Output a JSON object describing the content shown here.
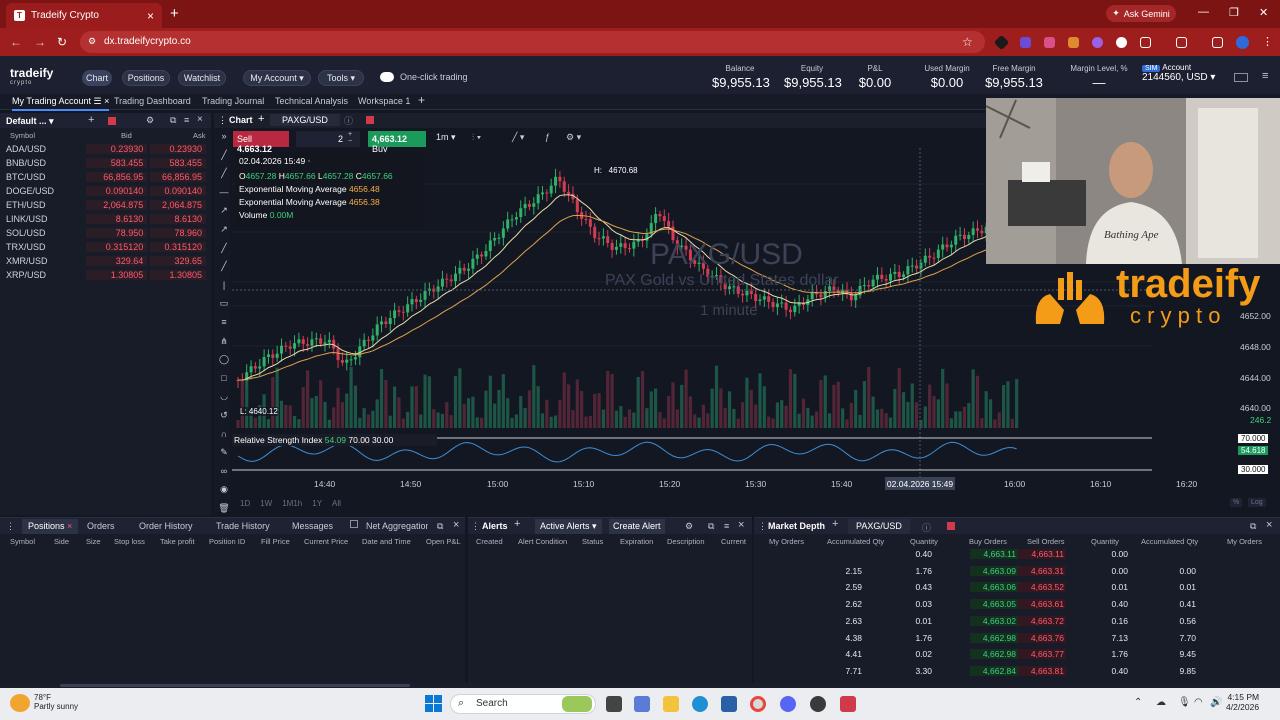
{
  "browser": {
    "tab_title": "Tradeify Crypto",
    "url": "dx.tradeifycrypto.co",
    "ask_gemini": "Ask Gemini"
  },
  "app": {
    "logo_main": "tradeify",
    "logo_sub": "crypto",
    "nav": [
      "Chart",
      "Positions",
      "Watchlist"
    ],
    "my_account": "My Account",
    "tools": "Tools",
    "one_click": "One-click trading",
    "stats": [
      {
        "label": "Balance",
        "value": "$9,955.13"
      },
      {
        "label": "Equity",
        "value": "$9,955.13"
      },
      {
        "label": "P&L",
        "value": "$0.00"
      },
      {
        "label": "Used Margin",
        "value": "$0.00"
      },
      {
        "label": "Free Margin",
        "value": "$9,955.13"
      },
      {
        "label": "Margin Level, %",
        "value": "—"
      }
    ],
    "account_tag": "SIM",
    "account_label": "Account",
    "account_value": "2144560, USD"
  },
  "workspace_tabs": [
    "My Trading Account",
    "Trading Dashboard",
    "Trading Journal",
    "Technical Analysis",
    "Workspace 1"
  ],
  "watchlist": {
    "title": "Default ...",
    "col_symbol": "Symbol",
    "col_bid": "Bid",
    "col_ask": "Ask",
    "rows": [
      {
        "sym": "ADA/USD",
        "bid": "0.23930",
        "ask": "0.23930"
      },
      {
        "sym": "BNB/USD",
        "bid": "583.455",
        "ask": "583.455"
      },
      {
        "sym": "BTC/USD",
        "bid": "66,856.95",
        "ask": "66,856.95"
      },
      {
        "sym": "DOGE/USD",
        "bid": "0.090140",
        "ask": "0.090140"
      },
      {
        "sym": "ETH/USD",
        "bid": "2,064.875",
        "ask": "2,064.875"
      },
      {
        "sym": "LINK/USD",
        "bid": "8.6130",
        "ask": "8.6130"
      },
      {
        "sym": "SOL/USD",
        "bid": "78.950",
        "ask": "78.960"
      },
      {
        "sym": "TRX/USD",
        "bid": "0.315120",
        "ask": "0.315120"
      },
      {
        "sym": "XMR/USD",
        "bid": "329.64",
        "ask": "329.65"
      },
      {
        "sym": "XRP/USD",
        "bid": "1.30805",
        "ask": "1.30805"
      }
    ]
  },
  "chart": {
    "panel_title": "Chart",
    "symbol": "PAXG/USD",
    "sell_label": "Sell",
    "sell_price": "4,663.12",
    "qty": "2",
    "buy_price": "4,663.12",
    "buy_label": "Buy",
    "interval": "1m",
    "info_date": "02.04.2026 15:49",
    "ohlc": {
      "o": "4657.28",
      "h": "4657.66",
      "l": "4657.28",
      "c": "4657.66"
    },
    "ema1_label": "Exponential Moving Average",
    "ema1_val": "4656.48",
    "ema2_label": "Exponential Moving Average",
    "ema2_val": "4656.38",
    "vol_label": "Volume",
    "vol_val": "0.00M",
    "high_label": "H:",
    "high_val": "4670.68",
    "low_label": "L:",
    "low_val": "4640.12",
    "wm_symbol": "PAXG/USD",
    "wm_name": "PAX Gold vs United States dollar",
    "wm_interval": "1 minute",
    "y_ticks": [
      "4652.00",
      "4648.00",
      "4644.00",
      "4640.00",
      "246.2"
    ],
    "x_ticks": [
      "14:40",
      "14:50",
      "15:00",
      "15:10",
      "15:20",
      "15:30",
      "15:40",
      "02.04.2026 15:49",
      "16:00",
      "16:10",
      "16:20"
    ],
    "rsi_label": "Relative Strength Index",
    "rsi_val": "54.09",
    "rsi_hi": "70.00",
    "rsi_lo": "30.00",
    "rsi_ticks": [
      "70.000",
      "54.618",
      "30.000"
    ],
    "ranges": [
      "1D",
      "1W",
      "1M1h",
      "1Y",
      "All"
    ],
    "log_btn": "Log"
  },
  "positions_panel": {
    "tabs": [
      "Positions",
      "Orders",
      "Order History",
      "Trade History",
      "Messages",
      "Net Aggregation"
    ],
    "columns": [
      "Symbol",
      "Side",
      "Size",
      "Stop loss",
      "Take profit",
      "Position ID",
      "Fill Price",
      "Current Price",
      "Date and Time",
      "Open P&L"
    ]
  },
  "alerts_panel": {
    "title": "Alerts",
    "active": "Active Alerts",
    "create": "Create Alert",
    "columns": [
      "Created",
      "Alert Condition",
      "Status",
      "Expiration",
      "Description",
      "Current"
    ]
  },
  "market_depth": {
    "title": "Market Depth",
    "symbol": "PAXG/USD",
    "columns": [
      "My Orders",
      "Accumulated Qty",
      "Quantity",
      "Buy Orders",
      "Sell Orders",
      "Quantity",
      "Accumulated Qty",
      "My Orders"
    ],
    "rows": [
      {
        "acc_b": "",
        "qty_b": "0.40",
        "buy": "4,663.11",
        "sell": "4,663.11",
        "qty_s": "0.00",
        "acc_s": ""
      },
      {
        "acc_b": "2.15",
        "qty_b": "1.76",
        "buy": "4,663.09",
        "sell": "4,663.31",
        "qty_s": "0.00",
        "acc_s": "0.00"
      },
      {
        "acc_b": "2.59",
        "qty_b": "0.43",
        "buy": "4,663.06",
        "sell": "4,663.52",
        "qty_s": "0.01",
        "acc_s": "0.01"
      },
      {
        "acc_b": "2.62",
        "qty_b": "0.03",
        "buy": "4,663.05",
        "sell": "4,663.61",
        "qty_s": "0.40",
        "acc_s": "0.41"
      },
      {
        "acc_b": "2.63",
        "qty_b": "0.01",
        "buy": "4,663.02",
        "sell": "4,663.72",
        "qty_s": "0.16",
        "acc_s": "0.56"
      },
      {
        "acc_b": "4.38",
        "qty_b": "1.76",
        "buy": "4,662.98",
        "sell": "4,663.76",
        "qty_s": "7.13",
        "acc_s": "7.70"
      },
      {
        "acc_b": "4.41",
        "qty_b": "0.02",
        "buy": "4,662.98",
        "sell": "4,663.77",
        "qty_s": "1.76",
        "acc_s": "9.45"
      },
      {
        "acc_b": "7.71",
        "qty_b": "3.30",
        "buy": "4,662.84",
        "sell": "4,663.81",
        "qty_s": "0.40",
        "acc_s": "9.85"
      }
    ]
  },
  "overlay": {
    "brand": "tradeify",
    "brand_sub": "c r y p t o"
  },
  "taskbar": {
    "weather_temp": "78°F",
    "weather_desc": "Partly sunny",
    "search": "Search",
    "time": "4:15 PM",
    "date": "4/2/2026"
  }
}
